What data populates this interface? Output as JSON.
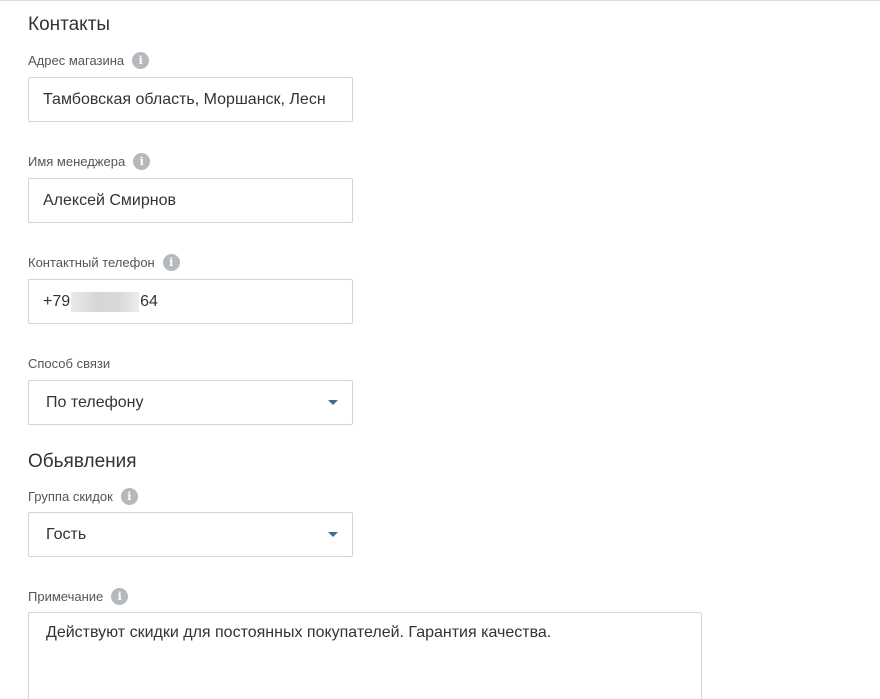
{
  "contacts": {
    "title": "Контакты",
    "address": {
      "label": "Адрес магазина",
      "value": "Тамбовская область, Моршанск, Лесн"
    },
    "manager": {
      "label": "Имя менеджера",
      "value": "Алексей Смирнов"
    },
    "phone": {
      "label": "Контактный телефон",
      "value_prefix": "+79",
      "value_suffix": "64"
    },
    "contact_method": {
      "label": "Способ связи",
      "selected": "По телефону"
    }
  },
  "ads": {
    "title": "Обьявления",
    "discount_group": {
      "label": "Группа скидок",
      "selected": "Гость"
    },
    "note": {
      "label": "Примечание",
      "value": "Действуют скидки для постоянных покупателей. Гарантия качества."
    }
  },
  "icons": {
    "info": "i"
  }
}
